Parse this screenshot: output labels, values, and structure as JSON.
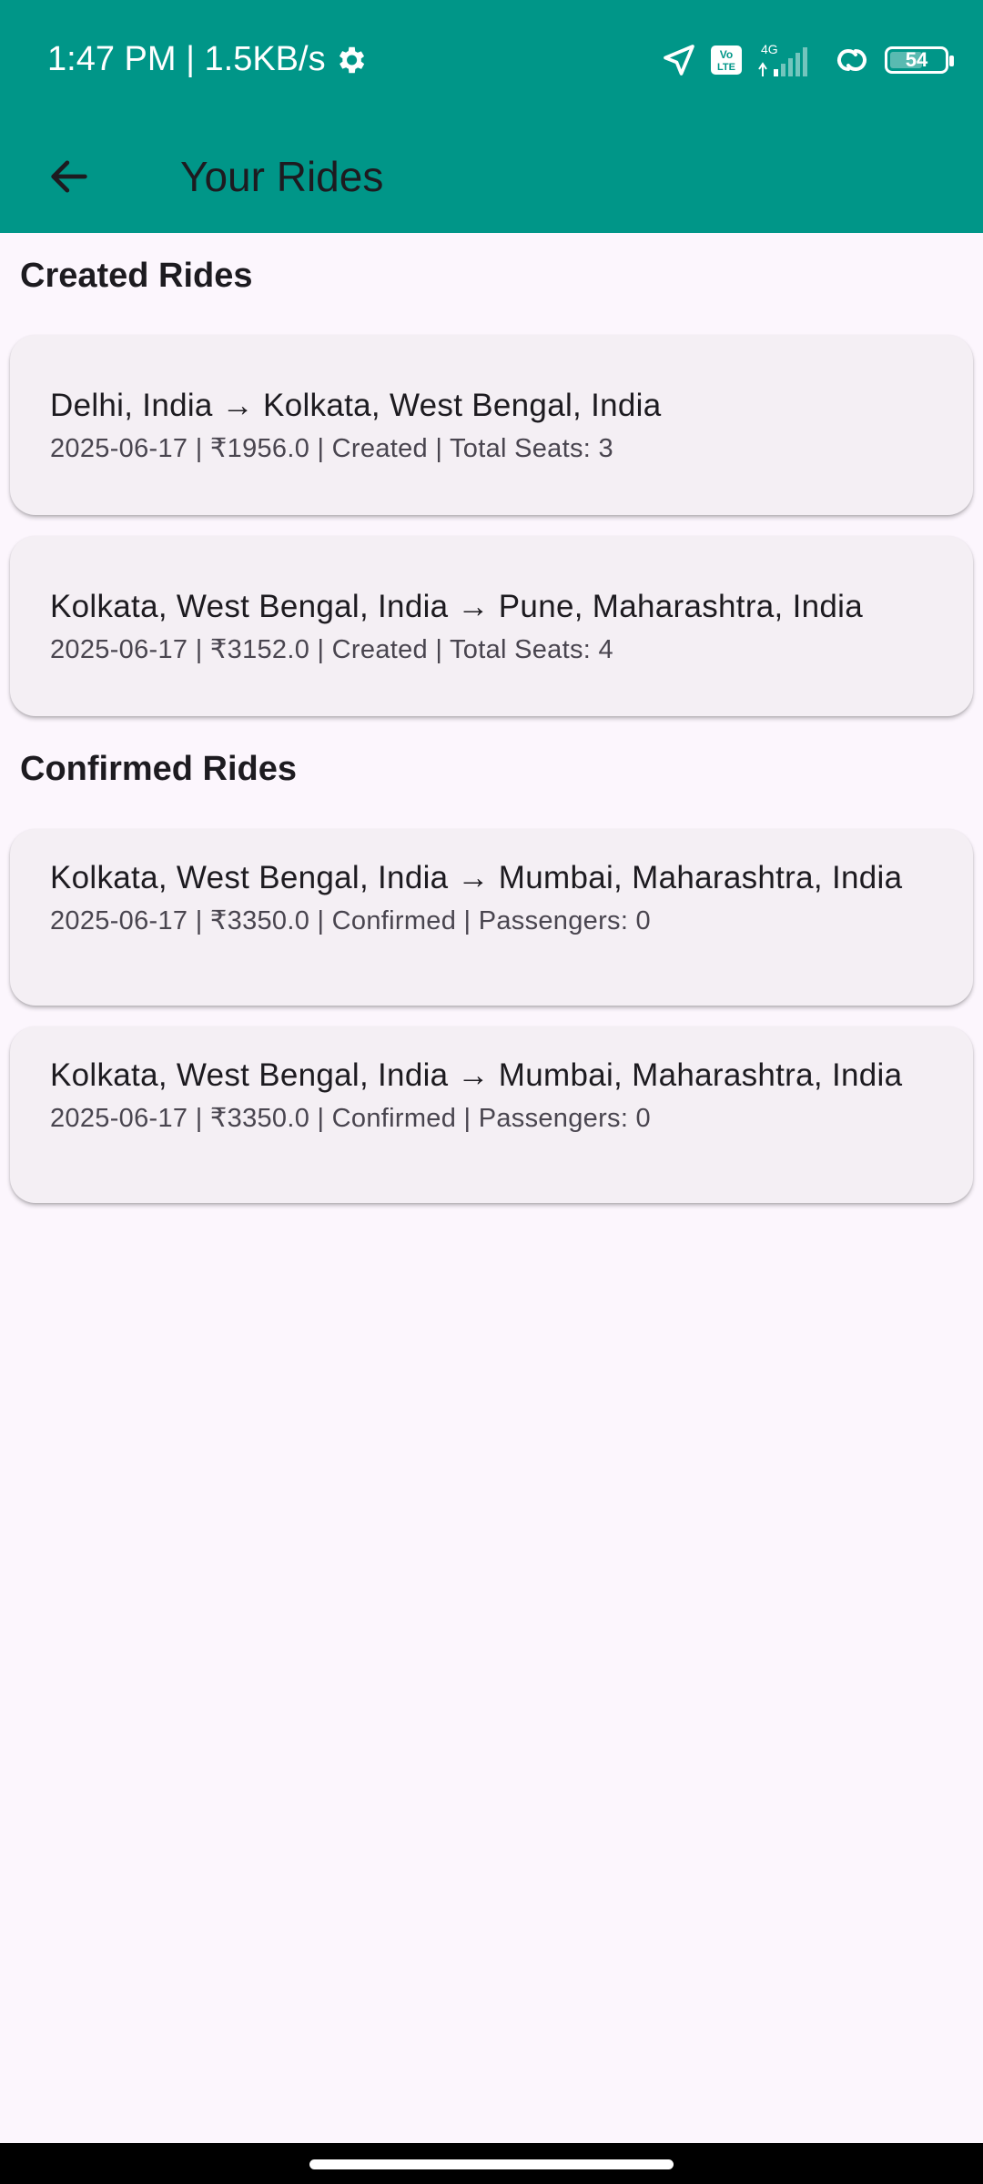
{
  "status_bar": {
    "time_speed": "1:47 PM | 1.5KB/s",
    "network_label": "4G",
    "volte_label": "Vo LTE",
    "battery": "54",
    "icons": [
      "settings-gear-icon",
      "location-arrow-icon",
      "volte-icon",
      "signal-icon",
      "hotspot-link-icon",
      "battery-icon"
    ]
  },
  "header": {
    "title": "Your Rides",
    "back_icon": "arrow-left-icon",
    "background": "#009688"
  },
  "sections": {
    "created": {
      "title": "Created Rides",
      "rides": [
        {
          "route": "Delhi, India → Kolkata, West Bengal, India",
          "details": "2025-06-17 | ₹1956.0 | Created | Total Seats: 3"
        },
        {
          "route": "Kolkata, West Bengal, India → Pune, Maharashtra, India",
          "details": "2025-06-17 | ₹3152.0 | Created | Total Seats: 4"
        }
      ]
    },
    "confirmed": {
      "title": "Confirmed Rides",
      "rides": [
        {
          "route": "Kolkata, West Bengal, India → Mumbai, Maharashtra, India",
          "details": "2025-06-17 | ₹3350.0 | Confirmed | Passengers: 0"
        },
        {
          "route": "Kolkata, West Bengal, India → Mumbai, Maharashtra, India",
          "details": "2025-06-17 | ₹3350.0 | Confirmed | Passengers: 0"
        }
      ]
    }
  }
}
